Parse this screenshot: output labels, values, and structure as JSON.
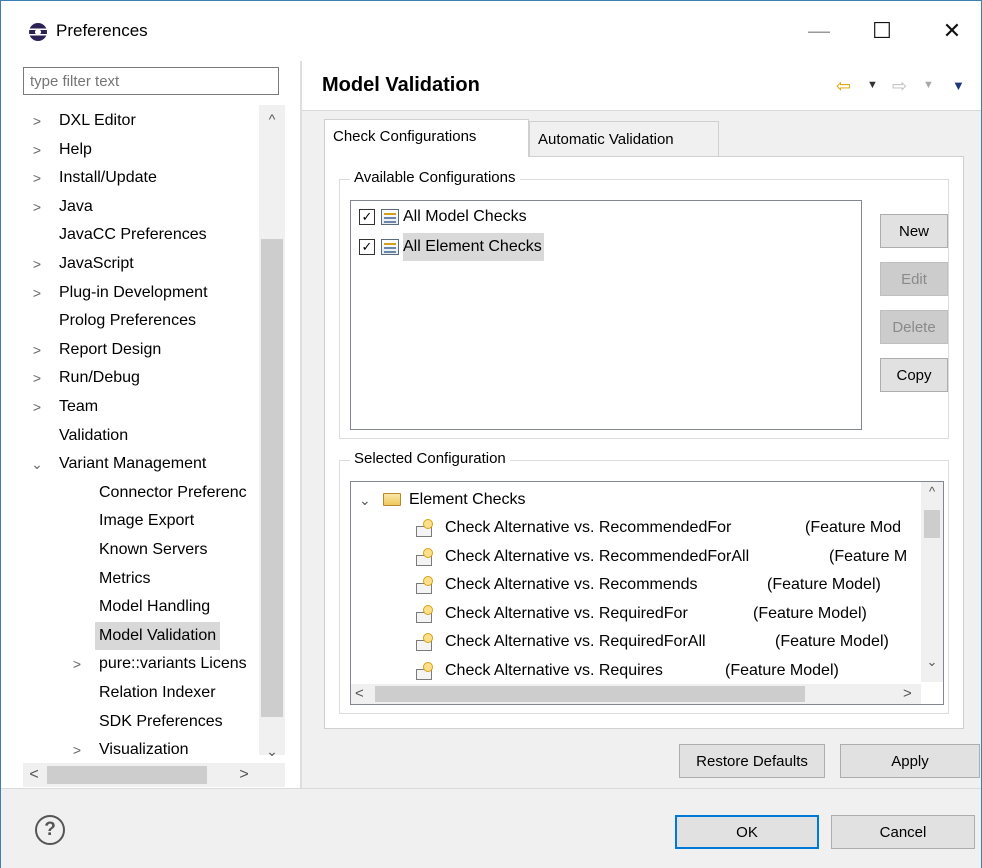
{
  "window": {
    "title": "Preferences",
    "minimize": "—",
    "maximize": "☐",
    "close": "✕"
  },
  "filter": {
    "placeholder": "type filter text"
  },
  "tree": {
    "items": [
      {
        "label": "DXL Editor",
        "expander": ">"
      },
      {
        "label": "Help",
        "expander": ">"
      },
      {
        "label": "Install/Update",
        "expander": ">"
      },
      {
        "label": "Java",
        "expander": ">"
      },
      {
        "label": "JavaCC Preferences",
        "expander": ""
      },
      {
        "label": "JavaScript",
        "expander": ">"
      },
      {
        "label": "Plug-in Development",
        "expander": ">"
      },
      {
        "label": "Prolog Preferences",
        "expander": ""
      },
      {
        "label": "Report Design",
        "expander": ">"
      },
      {
        "label": "Run/Debug",
        "expander": ">"
      },
      {
        "label": "Team",
        "expander": ">"
      },
      {
        "label": "Validation",
        "expander": ""
      },
      {
        "label": "Variant Management",
        "expander": "⌄"
      },
      {
        "label": "Connector Preferenc",
        "expander": ""
      },
      {
        "label": "Image Export",
        "expander": ""
      },
      {
        "label": "Known Servers",
        "expander": ""
      },
      {
        "label": "Metrics",
        "expander": ""
      },
      {
        "label": "Model Handling",
        "expander": ""
      },
      {
        "label": "Model Validation",
        "expander": "",
        "selected": true
      },
      {
        "label": "pure::variants Licens",
        "expander": ">"
      },
      {
        "label": "Relation Indexer",
        "expander": ""
      },
      {
        "label": "SDK Preferences",
        "expander": ""
      },
      {
        "label": "Visualization",
        "expander": ">"
      }
    ],
    "scroll_up": "^",
    "scroll_down": "⌄",
    "scroll_left": "<",
    "scroll_right": ">"
  },
  "page": {
    "title": "Model Validation",
    "back_icon": "⇦",
    "forward_icon": "⇨",
    "dropdown": "▼",
    "view_menu": "▼"
  },
  "tabs": [
    {
      "label": "Check Configurations",
      "active": true
    },
    {
      "label": "Automatic Validation",
      "active": false
    }
  ],
  "available": {
    "title": "Available Configurations",
    "items": [
      {
        "label": "All Model Checks",
        "checked": true,
        "selected": false
      },
      {
        "label": "All Element Checks",
        "checked": true,
        "selected": true
      }
    ],
    "checkmark": "✓",
    "buttons": {
      "new": "New",
      "edit": "Edit",
      "delete": "Delete",
      "copy": "Copy"
    }
  },
  "selected": {
    "title": "Selected Configuration",
    "root": {
      "label": "Element Checks",
      "expander": "⌄"
    },
    "checks": [
      {
        "name": "Check Alternative vs. RecommendedFor",
        "model": "(Feature Mod"
      },
      {
        "name": "Check Alternative vs. RecommendedForAll",
        "model": "(Feature M"
      },
      {
        "name": "Check Alternative vs. Recommends",
        "model": "(Feature Model)"
      },
      {
        "name": "Check Alternative vs. RequiredFor",
        "model": "(Feature Model)"
      },
      {
        "name": "Check Alternative vs. RequiredForAll",
        "model": "(Feature Model)"
      },
      {
        "name": "Check Alternative vs. Requires",
        "model": "(Feature Model)"
      }
    ],
    "scroll_up": "^",
    "scroll_down": "⌄",
    "scroll_left": "<",
    "scroll_right": ">"
  },
  "footer": {
    "restore_defaults": "Restore Defaults",
    "apply": "Apply",
    "ok": "OK",
    "cancel": "Cancel",
    "help": "?"
  }
}
